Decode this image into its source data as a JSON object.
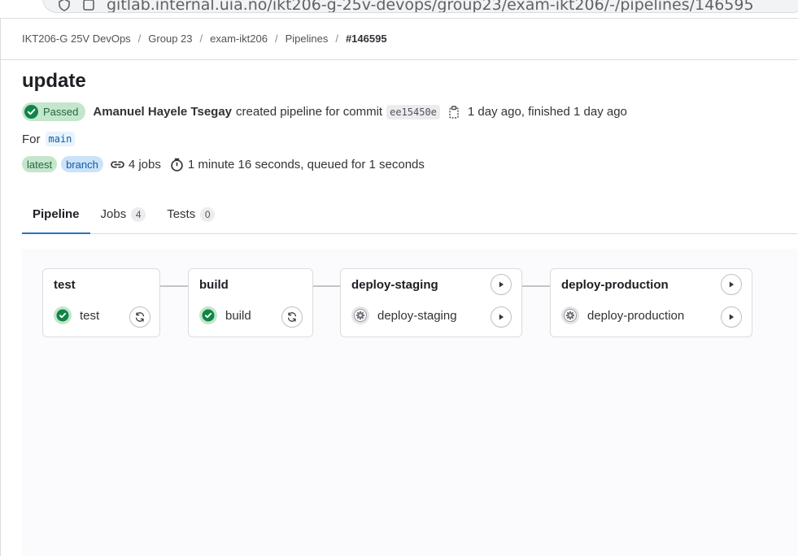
{
  "browser": {
    "url": "gitlab.internal.uia.no/ikt206-g-25v-devops/group23/exam-ikt206/-/pipelines/146595"
  },
  "breadcrumb": [
    {
      "label": "IKT206-G 25V DevOps"
    },
    {
      "label": "Group 23"
    },
    {
      "label": "exam-ikt206"
    },
    {
      "label": "Pipelines"
    },
    {
      "label": "#146595"
    }
  ],
  "breadcrumb_separator": "/",
  "pipeline": {
    "title": "update",
    "status": "Passed",
    "author": "Amanuel Hayele Tsegay",
    "created_text": "created pipeline for commit",
    "commit_sha": "ee15450e",
    "time_text": "1 day ago, finished 1 day ago",
    "for_label": "For",
    "ref": "main",
    "tags": [
      "latest",
      "branch"
    ],
    "jobs_text": "4 jobs",
    "duration_text": "1 minute 16 seconds, queued for 1 seconds"
  },
  "tabs": [
    {
      "label": "Pipeline",
      "count": null,
      "active": true
    },
    {
      "label": "Jobs",
      "count": "4",
      "active": false
    },
    {
      "label": "Tests",
      "count": "0",
      "active": false
    }
  ],
  "stages": [
    {
      "name": "test",
      "job": "test",
      "job_status": "success",
      "job_action": "retry"
    },
    {
      "name": "build",
      "job": "build",
      "job_status": "success",
      "job_action": "retry"
    },
    {
      "name": "deploy-staging",
      "job": "deploy-staging",
      "job_status": "manual",
      "job_action": "play",
      "stage_action": "play"
    },
    {
      "name": "deploy-production",
      "job": "deploy-production",
      "job_status": "manual",
      "job_action": "play",
      "stage_action": "play"
    }
  ],
  "colors": {
    "success": "#108548",
    "success_bg": "#c3e6cd",
    "link_blue": "#1f75cb",
    "manual_gray": "#737278"
  },
  "icons": {
    "status_success": "check-circle-icon",
    "status_manual": "gear-icon",
    "retry": "retry-icon",
    "play": "play-icon",
    "clipboard": "clipboard-icon",
    "jobs": "pipeline-jobs-icon",
    "timer": "timer-icon"
  }
}
